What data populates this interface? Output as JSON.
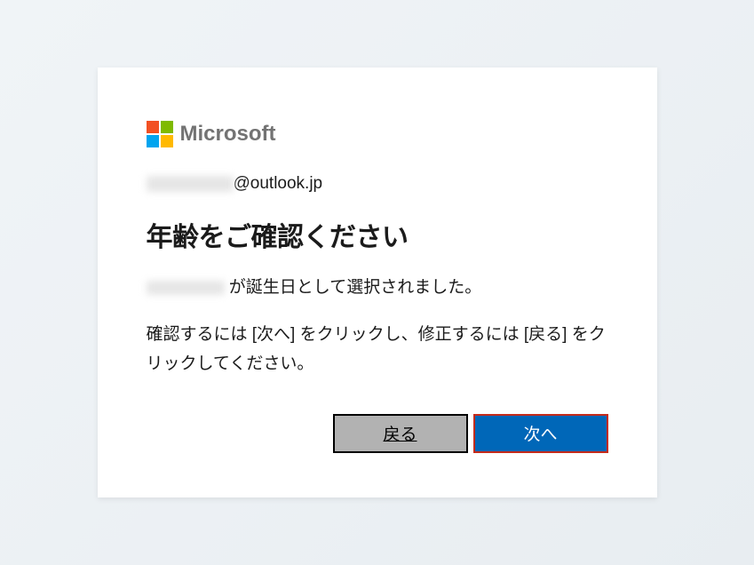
{
  "brand": {
    "name": "Microsoft"
  },
  "account": {
    "email_domain": "@outlook.jp"
  },
  "dialog": {
    "title": "年齢をご確認ください",
    "birthday_suffix": " が誕生日として選択されました。",
    "instruction": "確認するには [次へ] をクリックし、修正するには [戻る] をクリックしてください。"
  },
  "buttons": {
    "back": "戻る",
    "next": "次へ"
  }
}
